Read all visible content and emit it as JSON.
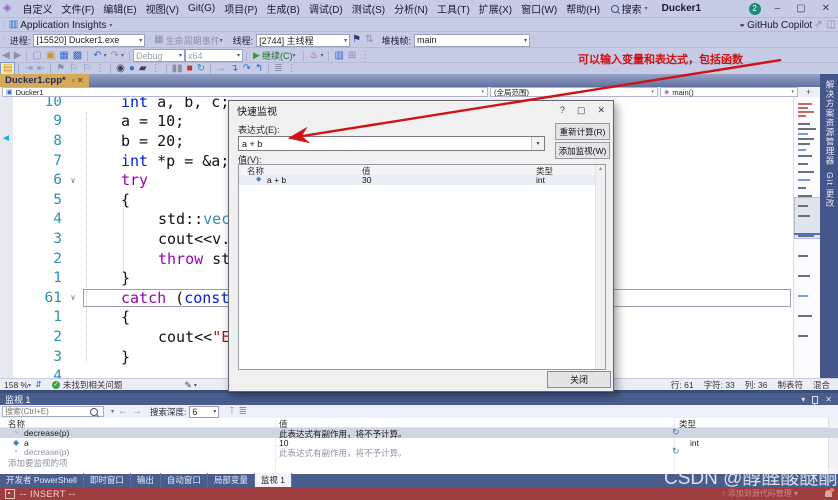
{
  "window": {
    "menus": [
      "自定义",
      "文件(F)",
      "编辑(E)",
      "视图(V)",
      "Git(G)",
      "项目(P)",
      "生成(B)",
      "调试(D)",
      "测试(S)",
      "分析(N)",
      "工具(T)",
      "扩展(X)",
      "窗口(W)",
      "帮助(H)"
    ],
    "search_label": "搜索",
    "title": "Ducker1",
    "avatar_badge": "2",
    "minimize": "–",
    "maximize": "▢",
    "close": "✕"
  },
  "toolbars": {
    "app_insights": "Application Insights",
    "copilot": "GitHub Copilot",
    "process_label": "进程:",
    "process_value": "[15520] Ducker1.exe",
    "lifecycle_label": "生命周期事件",
    "thread_label": "线程:",
    "thread_value": "[2744] 主线程",
    "frame_label": "堆栈帧:",
    "frame_value": "main",
    "std": [
      {
        "i": "◀",
        "n": "nav-back-icon",
        "c": "dim"
      },
      {
        "i": "▶",
        "n": "nav-forward-icon",
        "c": "dim"
      },
      {
        "sep": 1
      },
      {
        "i": "▢",
        "n": "new-file-icon",
        "c": "dim"
      },
      {
        "i": "▣",
        "n": "open-file-icon",
        "c": "gold"
      },
      {
        "i": "▦",
        "n": "save-icon",
        "c": "blue"
      },
      {
        "i": "▩",
        "n": "save-all-icon",
        "c": "blue"
      },
      {
        "sep": 1
      },
      {
        "i": "↶",
        "n": "undo-icon",
        "c": "blue",
        "dd": 1
      },
      {
        "i": "↷",
        "n": "redo-icon",
        "c": "dim",
        "dd": 1
      },
      {
        "sep": 1
      },
      {
        "combo": "Debug",
        "n": "configuration-select",
        "w": 46,
        "gray": 1
      },
      {
        "combo": "x64",
        "n": "platform-select",
        "w": 52,
        "gray": 1
      },
      {
        "sep": 1
      },
      {
        "play": "继续(C)",
        "n": "continue-button"
      },
      {
        "sep": 1
      },
      {
        "i": "♨",
        "n": "hot-reload-icon",
        "c": "red",
        "dd": 1
      },
      {
        "sep": 1
      },
      {
        "i": "▥",
        "n": "watch-window-icon",
        "c": "blue"
      },
      {
        "i": "⊞",
        "n": "window-layout-icon",
        "c": "dim"
      },
      {
        "i": "⋮",
        "n": "toolbar-overflow-icon",
        "c": "dim"
      }
    ],
    "debug": [
      {
        "i": "▤",
        "n": "diagnostics-note-icon",
        "c": "gold",
        "sel": 1
      },
      {
        "sep": 1
      },
      {
        "i": "⇥",
        "n": "run-to-cursor-icon",
        "c": "dim"
      },
      {
        "i": "⇤",
        "n": "set-next-statement-icon",
        "c": "dim"
      },
      {
        "sep": 1
      },
      {
        "i": "⚑",
        "n": "toggle-bookmark-icon",
        "c": "dim"
      },
      {
        "i": "⚐",
        "n": "prev-bookmark-icon",
        "c": "dim"
      },
      {
        "i": "⚐",
        "n": "next-bookmark-icon",
        "c": "dim"
      },
      {
        "i": "⋮",
        "n": "bookmark-overflow-icon",
        "c": "dim"
      },
      {
        "sep": 1
      },
      {
        "i": "◉",
        "n": "intellitrace-icon",
        "c": "dark"
      },
      {
        "i": "●",
        "n": "diagnostic-events-icon",
        "c": "blue"
      },
      {
        "i": "▰",
        "n": "performance-profiler-icon",
        "c": "dark"
      },
      {
        "i": "⋮",
        "n": "diagnostics-overflow-icon",
        "c": "dim"
      },
      {
        "sep": 1
      },
      {
        "i": "▮▮",
        "n": "pause-icon",
        "c": "dim"
      },
      {
        "i": "■",
        "n": "stop-debugging-icon",
        "c": "red"
      },
      {
        "i": "↻",
        "n": "restart-icon",
        "c": "teal"
      },
      {
        "sep": 1
      },
      {
        "i": "→",
        "n": "show-next-statement-icon",
        "c": "dim"
      },
      {
        "i": "↴",
        "n": "step-into-icon",
        "c": "blue"
      },
      {
        "i": "↷",
        "n": "step-over-icon",
        "c": "blue"
      },
      {
        "i": "↰",
        "n": "step-out-icon",
        "c": "blue"
      },
      {
        "sep": 1
      },
      {
        "i": "≣",
        "n": "immediate-window-icon",
        "c": "dim"
      },
      {
        "i": "⋮",
        "n": "debug-overflow-icon",
        "c": "dim"
      }
    ]
  },
  "editor": {
    "tab": "Ducker1.cpp*",
    "nav": [
      "Ducker1",
      "(全局范围)",
      "main()"
    ],
    "lines": [
      {
        "n": "10",
        "l": 1,
        "tk": [
          [
            "k",
            "int"
          ],
          [
            "p",
            " a, b, c;"
          ]
        ]
      },
      {
        "n": "9",
        "l": 1,
        "tk": [
          [
            "p",
            "a = 10;"
          ]
        ]
      },
      {
        "n": "8",
        "l": 1,
        "tk": [
          [
            "p",
            "b = 20;"
          ]
        ]
      },
      {
        "n": "7",
        "l": 1,
        "tk": [
          [
            "k",
            "int"
          ],
          [
            "p",
            " *p = &a;"
          ]
        ]
      },
      {
        "n": "6",
        "f": 1,
        "l": 1,
        "tk": [
          [
            "c",
            "try"
          ]
        ]
      },
      {
        "n": "5",
        "l": 1,
        "tk": [
          [
            "p",
            "{"
          ]
        ]
      },
      {
        "n": "4",
        "l": 2,
        "tk": [
          [
            "p",
            "std::"
          ],
          [
            "t",
            "vec"
          ]
        ]
      },
      {
        "n": "3",
        "l": 2,
        "tk": [
          [
            "p",
            "cout<<v."
          ]
        ]
      },
      {
        "n": "2",
        "l": 2,
        "tk": [
          [
            "c",
            "throw"
          ],
          [
            "p",
            " st"
          ]
        ]
      },
      {
        "n": "1",
        "l": 1,
        "tk": [
          [
            "p",
            "}"
          ]
        ]
      },
      {
        "n": "61",
        "f": 1,
        "l": 1,
        "cr": 1,
        "tk": [
          [
            "c",
            "catch"
          ],
          [
            "p",
            " ("
          ],
          [
            "k",
            "const"
          ]
        ]
      },
      {
        "n": "1",
        "l": 1,
        "tk": [
          [
            "p",
            "{"
          ]
        ]
      },
      {
        "n": "2",
        "l": 2,
        "tk": [
          [
            "p",
            "cout<<"
          ],
          [
            "s",
            "\"E"
          ]
        ]
      },
      {
        "n": "3",
        "l": 1,
        "tk": [
          [
            "p",
            "}"
          ]
        ]
      },
      {
        "n": "4",
        "l": 1,
        "tk": []
      }
    ],
    "status": {
      "zoom": "158 %",
      "issues": "未找到相关问题",
      "line": "行: 61",
      "char": "字符: 33",
      "col": "列: 36",
      "tabs": "制表符",
      "encoding": "混合"
    },
    "minimap_marks": [
      [
        6,
        "r",
        14
      ],
      [
        10,
        "r",
        10
      ],
      [
        14,
        "r",
        16
      ],
      [
        18,
        "r",
        8
      ],
      [
        26,
        "d",
        12
      ],
      [
        31,
        "d",
        18
      ],
      [
        36,
        "b",
        10
      ],
      [
        41,
        "d",
        16
      ],
      [
        46,
        "d",
        12
      ],
      [
        52,
        "b",
        8
      ],
      [
        58,
        "d",
        14
      ],
      [
        66,
        "d",
        10
      ],
      [
        74,
        "d",
        16
      ],
      [
        82,
        "b",
        12
      ],
      [
        90,
        "d",
        8
      ],
      [
        98,
        "d",
        14
      ],
      [
        108,
        "d",
        10
      ],
      [
        118,
        "d",
        12
      ],
      [
        138,
        "d",
        16
      ],
      [
        158,
        "d",
        10
      ],
      [
        178,
        "d",
        12
      ],
      [
        198,
        "b",
        10
      ],
      [
        218,
        "d",
        14
      ],
      [
        238,
        "d",
        10
      ]
    ]
  },
  "side_tabs": [
    "解决方案资源管理器",
    "Git 更改"
  ],
  "dialog": {
    "title": "快速监视",
    "help": "?",
    "max": "▢",
    "close_x": "✕",
    "expression_label": "表达式(E):",
    "expression_value": "a + b",
    "reevaluate": "重新计算(R)",
    "add_watch": "添加监视(W)",
    "value_label": "值(V):",
    "columns": [
      "名称",
      "值",
      "类型"
    ],
    "rows": [
      {
        "name": "a + b",
        "value": "30",
        "type": "int"
      }
    ],
    "close": "关闭"
  },
  "annotation": {
    "text": "可以输入变量和表达式，包括函数"
  },
  "watch": {
    "title": "监视 1",
    "search_placeholder": "搜索(Ctrl+E)",
    "depth_label": "搜索深度:",
    "depth_value": "6",
    "columns": [
      "名称",
      "值",
      "类型"
    ],
    "rows": [
      {
        "name": "decrease(p)",
        "value": "此表达式有副作用，将不予计算。",
        "type": "",
        "refresh": true,
        "selected": true
      },
      {
        "name": "a",
        "value": "10",
        "type": "int",
        "diamond": true
      },
      {
        "name": "decrease(p)",
        "value": "此表达式有副作用，将不予计算。",
        "type": "",
        "refresh": true,
        "gray": true
      },
      {
        "name": "添加要监视的项",
        "add": true
      }
    ]
  },
  "panel_tabs": {
    "items": [
      "开发者 PowerShell",
      "即时窗口",
      "输出",
      "自动窗口",
      "局部变量",
      "监视 1"
    ],
    "active": "监视 1"
  },
  "statusbar": {
    "mode": "-- INSERT --",
    "source_control": "↑ 添加到源代码管理 ▾"
  },
  "watermark": "CSDN @醇醛酸醚酮酯",
  "colors": {
    "accent_tab": "#d5a95a",
    "panel_blue": "#4a5e8e",
    "status_red": "#9e3e40",
    "annotation_red": "#cf1212",
    "chrome": "#c6cbe6"
  }
}
